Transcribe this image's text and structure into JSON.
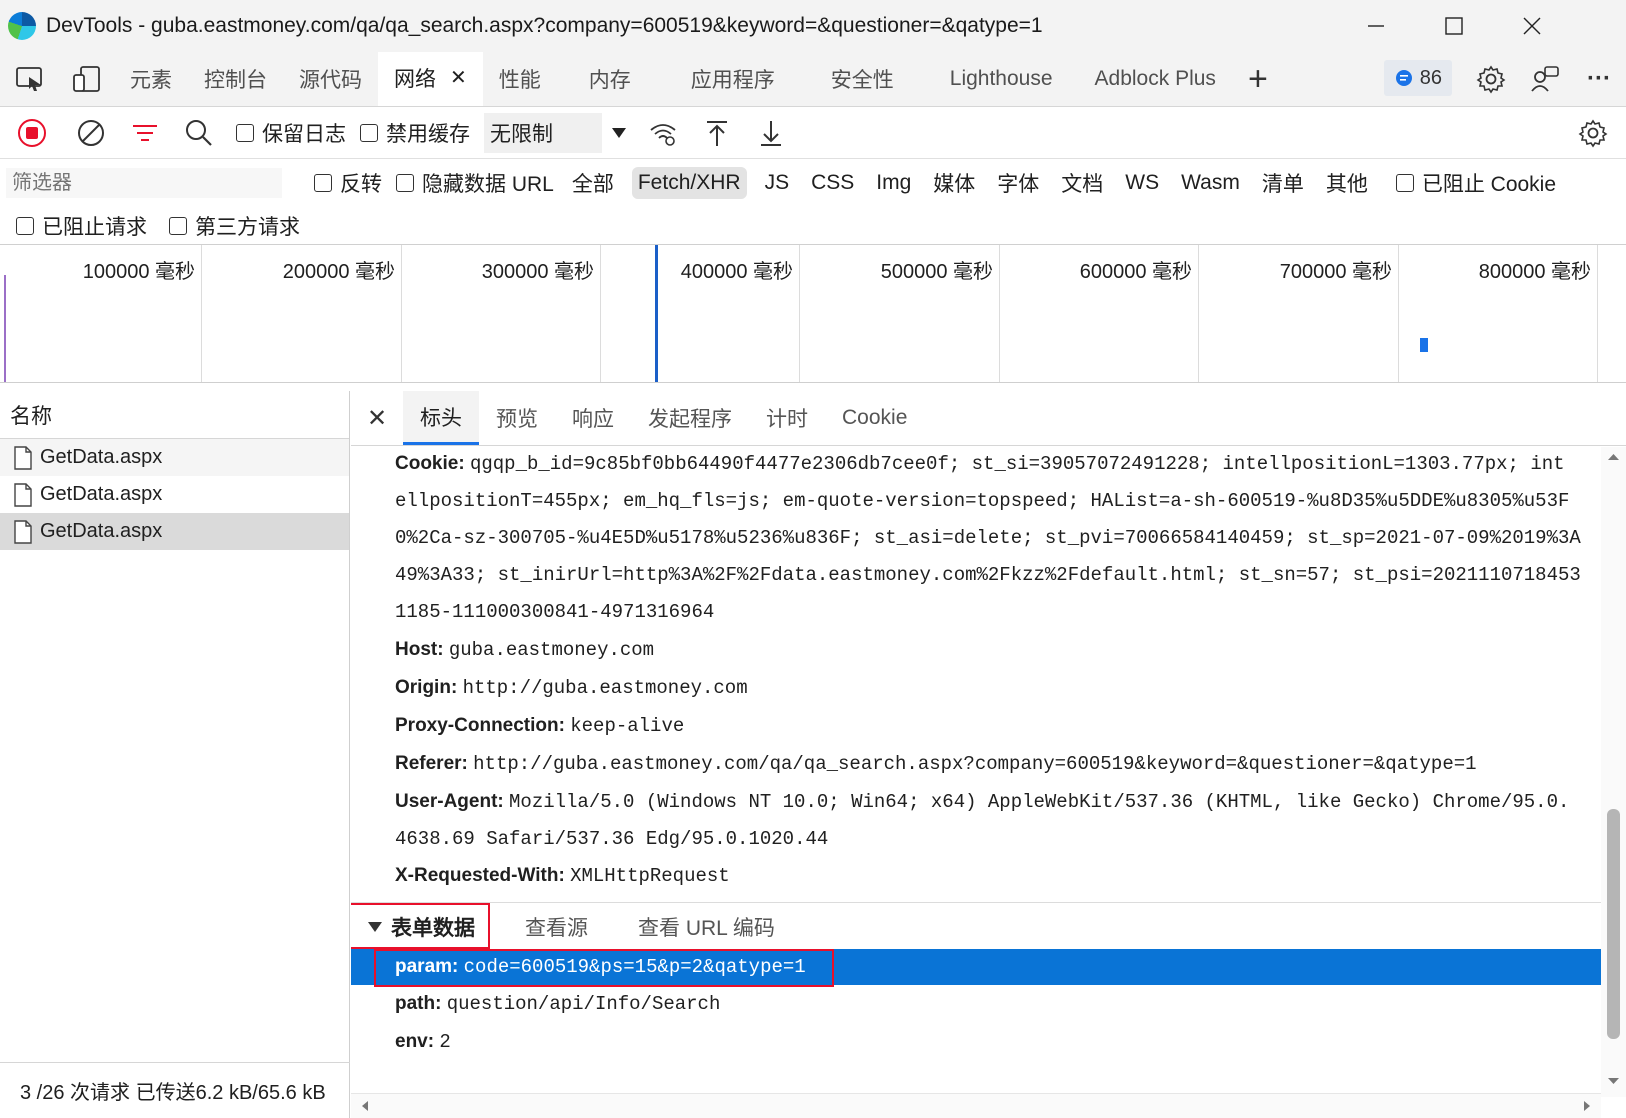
{
  "window": {
    "title": "DevTools - guba.eastmoney.com/qa/qa_search.aspx?company=600519&keyword=&questioner=&qatype=1",
    "minimize": "—",
    "maximize": "☐",
    "close": "✕"
  },
  "tabs": [
    {
      "label": "元素"
    },
    {
      "label": "控制台"
    },
    {
      "label": "源代码"
    },
    {
      "label": "网络",
      "close": "✕"
    },
    {
      "label": "性能"
    },
    {
      "label": "内存"
    },
    {
      "label": "应用程序"
    },
    {
      "label": "安全性"
    },
    {
      "label": "Lighthouse"
    },
    {
      "label": "Adblock Plus"
    }
  ],
  "tab_add": "+",
  "issues_count": "86",
  "more_label": "···",
  "toolbar": {
    "preserve_log": "保留日志",
    "disable_cache": "禁用缓存",
    "throttle": "无限制"
  },
  "filter": {
    "placeholder": "筛选器",
    "invert": "反转",
    "hide_data_urls": "隐藏数据 URL",
    "types": [
      "全部",
      "Fetch/XHR",
      "JS",
      "CSS",
      "Img",
      "媒体",
      "字体",
      "文档",
      "WS",
      "Wasm",
      "清单",
      "其他"
    ],
    "active_type": "Fetch/XHR",
    "blocked_cookies": "已阻止 Cookie",
    "blocked_requests": "已阻止请求",
    "third_party": "第三方请求"
  },
  "timeline": {
    "ticks": [
      "100000 毫秒",
      "200000 毫秒",
      "300000 毫秒",
      "400000 毫秒",
      "500000 毫秒",
      "600000 毫秒",
      "700000 毫秒",
      "800000 毫秒"
    ]
  },
  "requests": {
    "header": "名称",
    "items": [
      "GetData.aspx",
      "GetData.aspx",
      "GetData.aspx"
    ],
    "selected_index": 2,
    "status": "3 /26 次请求  已传送6.2 kB/65.6 kB"
  },
  "details": {
    "close": "✕",
    "tabs": [
      "标头",
      "预览",
      "响应",
      "发起程序",
      "计时",
      "Cookie"
    ],
    "active_tab": "标头",
    "headers": [
      {
        "key": "Cookie:",
        "lines": [
          "qgqp_b_id=9c85bf0bb64490f4477e2306db7cee0f; st_si=39057072491228; intellpositionL=1303.77px; int",
          "ellpositionT=455px; em_hq_fls=js; em-quote-version=topspeed; HAList=a-sh-600519-%u8D35%u5DDE%u8305%u53F",
          "0%2Ca-sz-300705-%u4E5D%u5178%u5236%u836F; st_asi=delete; st_pvi=70066584140459; st_sp=2021-07-09%2019%3A",
          "49%3A33; st_inirUrl=http%3A%2F%2Fdata.eastmoney.com%2Fkzz%2Fdefault.html; st_sn=57; st_psi=2021110718453",
          "1185-111000300841-4971316964"
        ]
      },
      {
        "key": "Host:",
        "lines": [
          "guba.eastmoney.com"
        ]
      },
      {
        "key": "Origin:",
        "lines": [
          "http://guba.eastmoney.com"
        ]
      },
      {
        "key": "Proxy-Connection:",
        "lines": [
          "keep-alive"
        ]
      },
      {
        "key": "Referer:",
        "lines": [
          "http://guba.eastmoney.com/qa/qa_search.aspx?company=600519&keyword=&questioner=&qatype=1"
        ]
      },
      {
        "key": "User-Agent:",
        "lines": [
          "Mozilla/5.0 (Windows NT 10.0; Win64; x64) AppleWebKit/537.36 (KHTML, like Gecko) Chrome/95.0.",
          "4638.69 Safari/537.36 Edg/95.0.1020.44"
        ]
      },
      {
        "key": "X-Requested-With:",
        "lines": [
          "XMLHttpRequest"
        ]
      }
    ],
    "form_section": {
      "title": "表单数据",
      "view_source": "查看源",
      "view_url_encoded": "查看 URL 编码",
      "fields": [
        {
          "key": "param:",
          "value": "code=600519&ps=15&p=2&qatype=1",
          "selected": true
        },
        {
          "key": "path:",
          "value": "question/api/Info/Search"
        },
        {
          "key": "env:",
          "value": "2"
        }
      ]
    }
  },
  "colors": {
    "accent": "#0a74d6",
    "record": "#e8102b",
    "highlight_box": "#e8102b"
  }
}
